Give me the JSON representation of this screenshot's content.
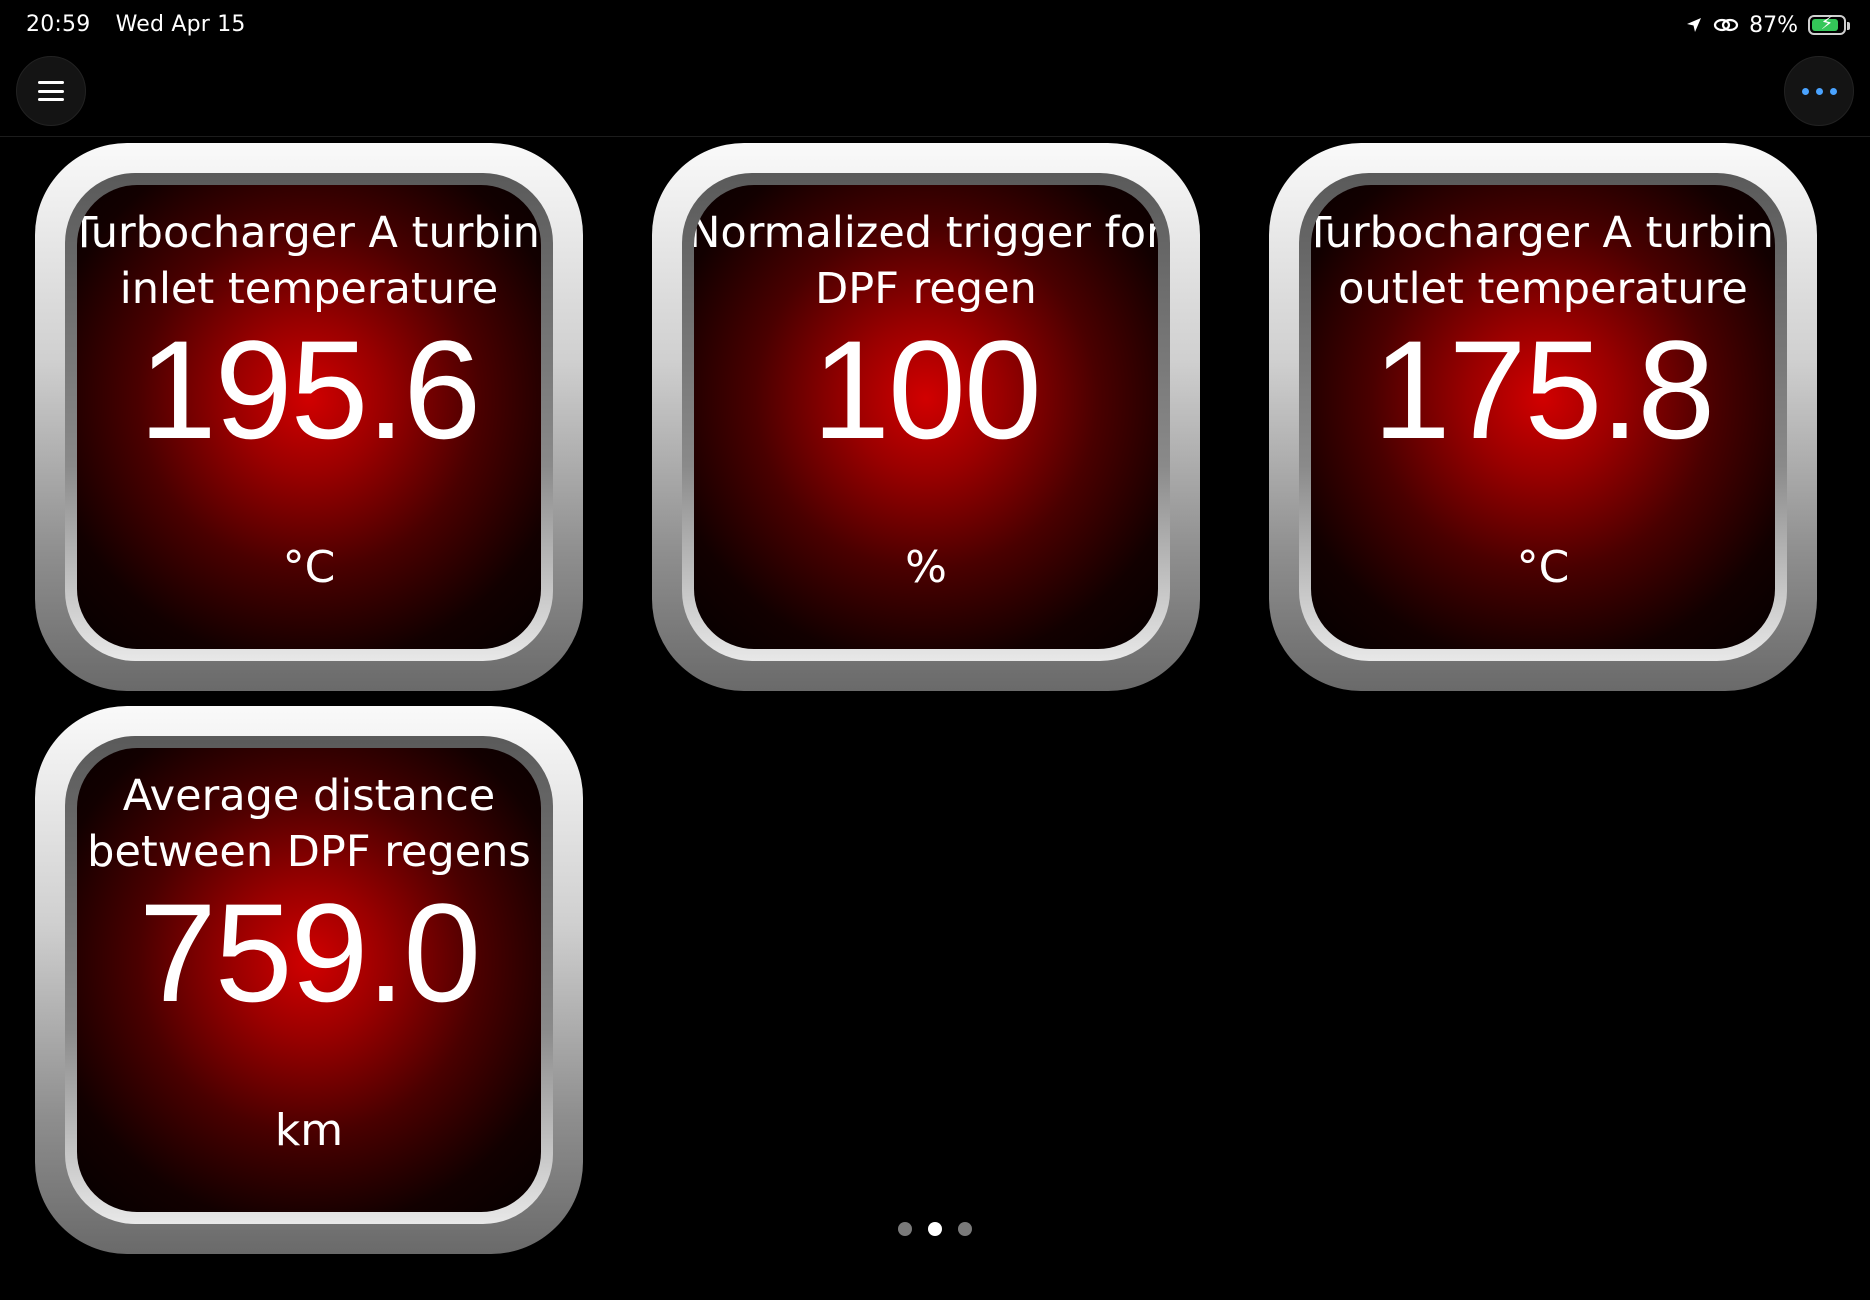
{
  "status_bar": {
    "time": "20:59",
    "date": "Wed Apr 15",
    "battery_percent": "87%",
    "battery_level": 0.87,
    "battery_color": "#34c759",
    "icons": [
      "location-arrow-icon",
      "link-icon",
      "battery-charging-icon"
    ]
  },
  "toolbar": {
    "left_icon": "hamburger-menu-icon",
    "right_icon": "ellipsis-more-icon",
    "accent_color": "#4aa3ff"
  },
  "gauges": [
    {
      "title_line1": "Turbocharger A turbine",
      "title_line2": "inlet temperature",
      "value": "195.6",
      "unit": "°C"
    },
    {
      "title_line1": "Normalized trigger for",
      "title_line2": "DPF regen",
      "value": "100",
      "unit": "%"
    },
    {
      "title_line1": "Turbocharger A turbine",
      "title_line2": "outlet temperature",
      "value": "175.8",
      "unit": "°C"
    },
    {
      "title_line1": "Average distance",
      "title_line2": "between DPF regens",
      "value": "759.0",
      "unit": "km"
    }
  ],
  "pager": {
    "pages": 3,
    "active_index": 1
  },
  "colors": {
    "gauge_face": "#d10000",
    "background": "#000000"
  }
}
